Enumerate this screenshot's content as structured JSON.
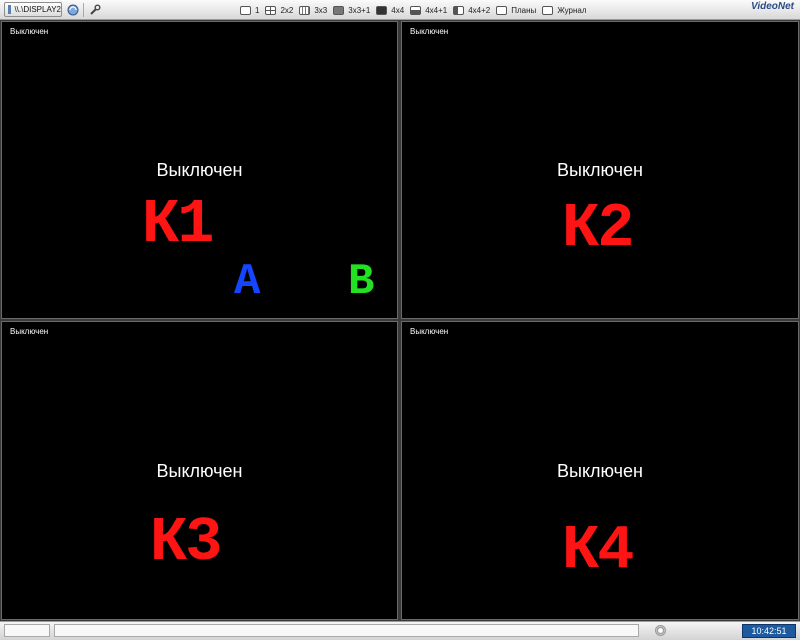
{
  "toolbar": {
    "display_tab": "\\\\.\\DISPLAY2",
    "layouts": [
      {
        "label": "1",
        "icon": "single-view-icon"
      },
      {
        "label": "2x2",
        "icon": "grid-2x2-icon"
      },
      {
        "label": "3x3",
        "icon": "grid-3x3-icon"
      },
      {
        "label": "3x3+1",
        "icon": "grid-3x3-plus1-icon"
      },
      {
        "label": "4x4",
        "icon": "grid-4x4-icon"
      },
      {
        "label": "4x4+1",
        "icon": "grid-4x4-plus1-icon"
      },
      {
        "label": "4x4+2",
        "icon": "grid-4x4-plus2-icon"
      },
      {
        "label": "Планы",
        "icon": "plans-icon"
      },
      {
        "label": "Журнал",
        "icon": "journal-icon"
      }
    ],
    "brand": "VideoNet"
  },
  "cameras": [
    {
      "status_small": "Выключен",
      "status_big": "Выключен",
      "label": "К1"
    },
    {
      "status_small": "Выключен",
      "status_big": "Выключен",
      "label": "К2"
    },
    {
      "status_small": "Выключен",
      "status_big": "Выключен",
      "label": "К3"
    },
    {
      "status_small": "Выключен",
      "status_big": "Выключен",
      "label": "К4"
    }
  ],
  "markers": {
    "a": "A",
    "b": "B",
    "a_color": "#1446ff",
    "b_color": "#22e022"
  },
  "colors": {
    "camera_label": "#ff1414",
    "clock_bg": "#1e5aa0"
  },
  "statusbar": {
    "clock": "10:42:51"
  }
}
